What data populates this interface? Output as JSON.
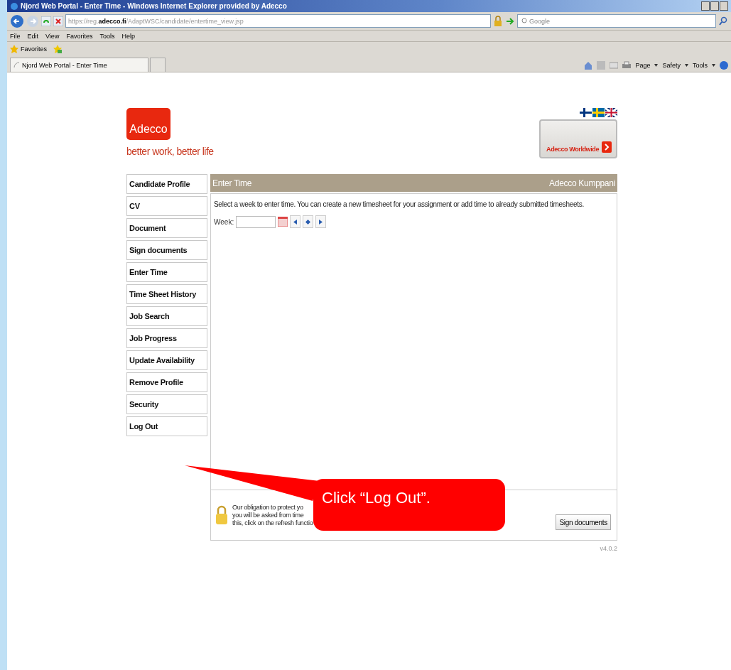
{
  "window": {
    "title": "Njord Web Portal - Enter Time - Windows Internet Explorer provided by Adecco"
  },
  "browser": {
    "url": "https://reg.**adecco.fi**/AdaptWSC/candidate/entertime_view.jsp",
    "search_placeholder": "Google",
    "menu": [
      "File",
      "Edit",
      "View",
      "Favorites",
      "Tools",
      "Help"
    ],
    "favorites_label": "Favorites",
    "tab_title": "Njord Web Portal - Enter Time",
    "commands": [
      "Page",
      "Safety",
      "Tools"
    ]
  },
  "page": {
    "logo": "Adecco",
    "tagline": "better work, better life",
    "worldwide_button": "Adecco Worldwide",
    "nav": [
      "Candidate Profile",
      "CV",
      "Document",
      "Sign documents",
      "Enter Time",
      "Time Sheet History",
      "Job Search",
      "Job Progress",
      "Update Availability",
      "Remove Profile",
      "Security",
      "Log Out"
    ],
    "header_title": "Enter Time",
    "header_right": "Adecco Kumppani",
    "instructions": "Select a week to enter time. You can create a new timesheet for your assignment or add time to already submitted timesheets.",
    "week_label": "Week:",
    "footer_lines": [
      "Our obligation to protect yo",
      "you will be asked from time",
      "this, click on the refresh functio"
    ],
    "sign_button": "Sign documents",
    "version": "v4.0.2"
  },
  "callout": {
    "text": "Click “Log Out”."
  }
}
